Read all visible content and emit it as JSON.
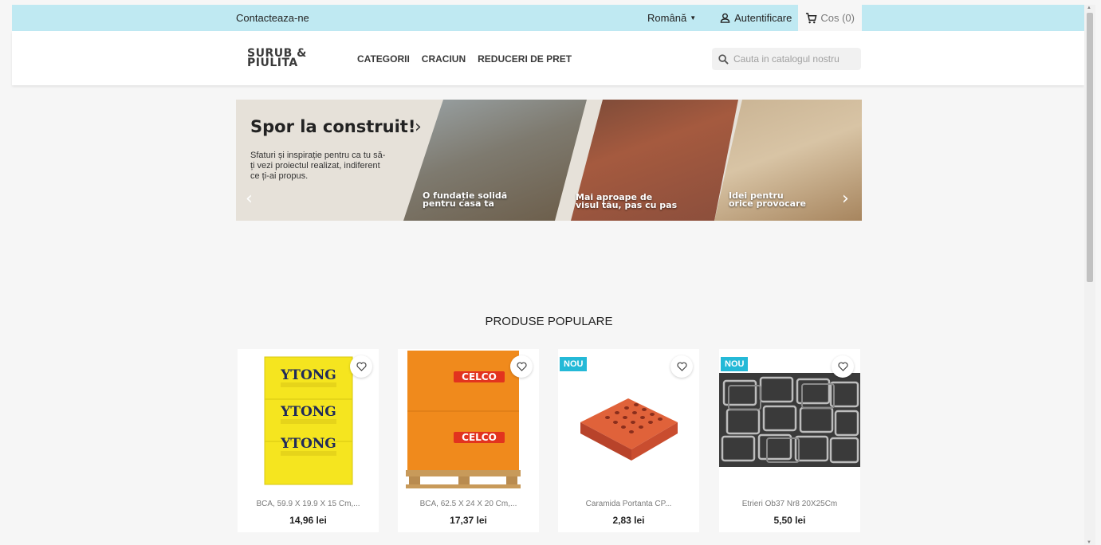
{
  "topbar": {
    "contact": "Contacteaza-ne",
    "language": "Română",
    "login": "Autentificare",
    "cart": "Cos (0)"
  },
  "header": {
    "logo_line1": "SURUB &",
    "logo_line2": "PIULITA",
    "nav": [
      "CATEGORII",
      "CRACIUN",
      "REDUCERI DE PRET"
    ],
    "search_placeholder": "Cauta in catalogul nostru"
  },
  "banner": {
    "title": "Spor la construit!",
    "subtitle": "Sfaturi și inspirație pentru ca tu să-ți vezi proiectul realizat, indiferent ce ți-ai propus.",
    "captions": [
      {
        "line1": "O fundație solidă",
        "line2": "pentru casa ta"
      },
      {
        "line1": "Mai aproape de",
        "line2": "visul tău, pas cu pas"
      },
      {
        "line1": "Idei pentru",
        "line2": "orice provocare"
      }
    ]
  },
  "section": {
    "title": "PRODUSE POPULARE"
  },
  "products": [
    {
      "name": "BCA, 59.9 X 19.9 X 15 Cm,...",
      "price": "14,96 lei",
      "badge": "",
      "brand": "YTONG"
    },
    {
      "name": "BCA, 62.5 X 24 X 20 Cm,...",
      "price": "17,37 lei",
      "badge": "",
      "brand": "CELCO"
    },
    {
      "name": "Caramida Portanta CP...",
      "price": "2,83 lei",
      "badge": "NOU",
      "brand": ""
    },
    {
      "name": "Etrieri Ob37 Nr8 20X25Cm",
      "price": "5,50 lei",
      "badge": "NOU",
      "brand": ""
    }
  ],
  "colors": {
    "topbar": "#bfe9f2",
    "badge": "#24b9d7",
    "ytong": "#f5e51f",
    "celco": "#f08a1c",
    "brick": "#d2522e"
  }
}
